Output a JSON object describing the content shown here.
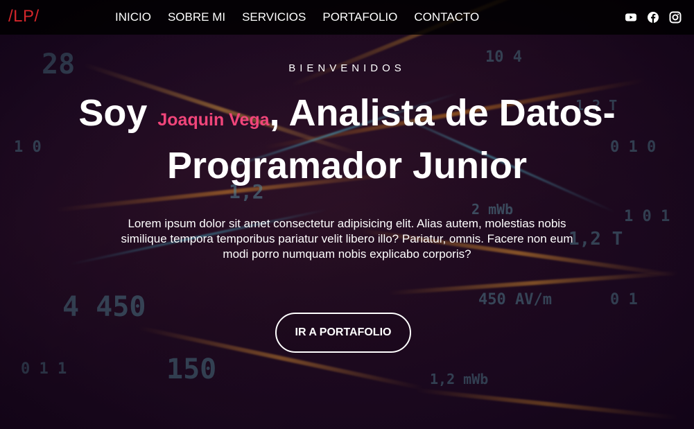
{
  "nav": {
    "logo": "/LP/",
    "links": [
      "INICIO",
      "SOBRE MI",
      "SERVICIOS",
      "PORTAFOLIO",
      "CONTACTO"
    ],
    "socials": [
      "youtube-icon",
      "facebook-icon",
      "instagram-icon"
    ]
  },
  "hero": {
    "welcome": "BIENVENIDOS",
    "headline_prefix": "Soy ",
    "name": "Joaquin Vega",
    "headline_suffix": ", Analista de Datos- Programador Junior",
    "description": "Lorem ipsum dolor sit amet consectetur adipisicing elit. Alias autem, molestias nobis similique tempora temporibus pariatur velit libero illo? Pariatur, omnis. Facere non eum modi porro numquam nobis explicabo corporis?",
    "cta_label": "IR A PORTAFOLIO"
  },
  "colors": {
    "logo": "#d4262b",
    "accent_name": "#f0457a",
    "nav_bg": "#000000"
  }
}
